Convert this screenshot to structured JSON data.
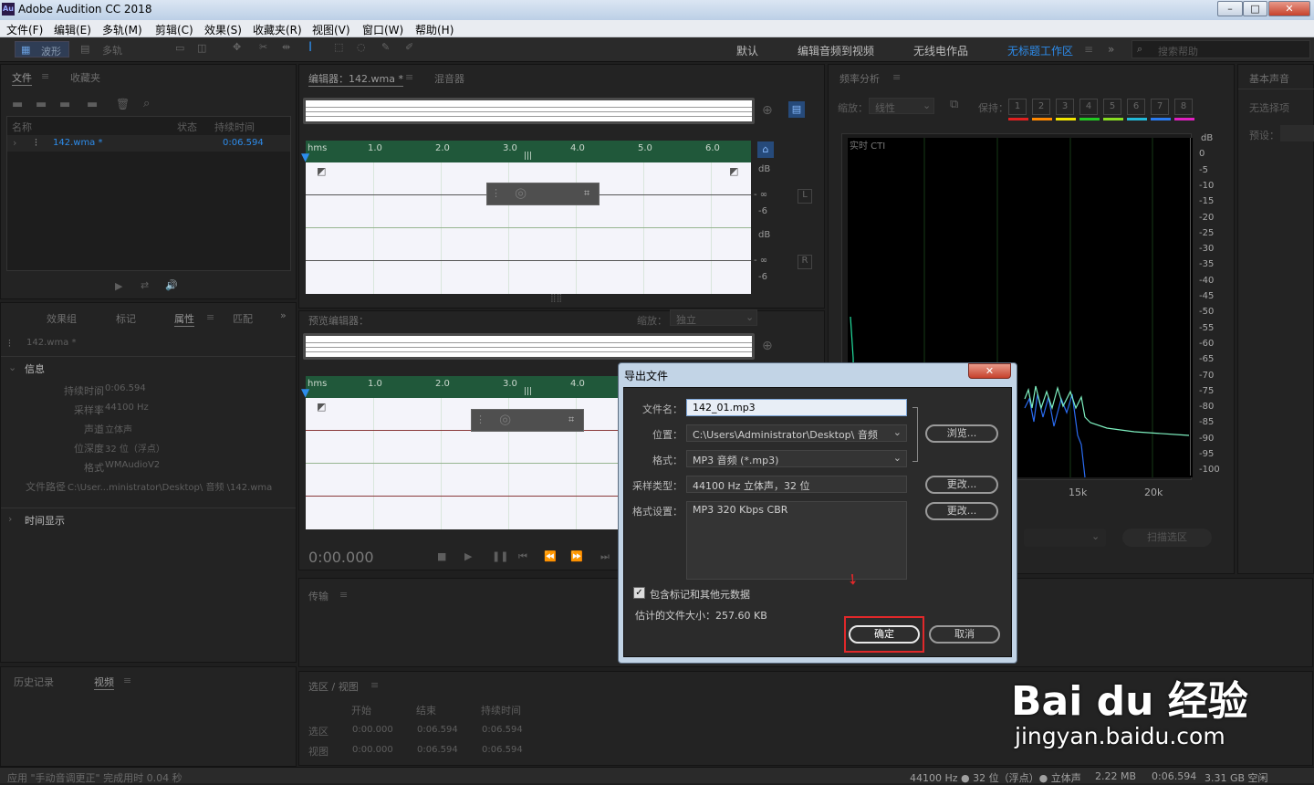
{
  "app": {
    "title": "Adobe Audition CC 2018",
    "logo": "Au"
  },
  "window_controls": [
    "–",
    "□",
    "✕"
  ],
  "menu": [
    "文件(F)",
    "编辑(E)",
    "多轨(M)",
    "剪辑(C)",
    "效果(S)",
    "收藏夹(R)",
    "视图(V)",
    "窗口(W)",
    "帮助(H)"
  ],
  "toolbar": {
    "waveform": "波形",
    "multitrack": "多轨",
    "workspaces": [
      "默认",
      "编辑音频到视频",
      "无线电作品",
      "无标题工作区"
    ],
    "search_placeholder": "搜索帮助"
  },
  "files_panel": {
    "tabs": [
      "文件",
      "收藏夹"
    ],
    "col_name": "名称",
    "col_status": "状态",
    "col_duration": "持续时间",
    "file_name": "142.wma *",
    "file_duration": "0:06.594"
  },
  "props_panel": {
    "tabs": [
      "效果组",
      "标记",
      "属性",
      "匹配"
    ],
    "file": "142.wma *",
    "section_info": "信息",
    "rows": [
      {
        "k": "持续时间",
        "v": "0:06.594"
      },
      {
        "k": "采样率",
        "v": "44100 Hz"
      },
      {
        "k": "声道",
        "v": "立体声"
      },
      {
        "k": "位深度",
        "v": "32 位（浮点）"
      },
      {
        "k": "格式",
        "v": "WMAudioV2"
      },
      {
        "k": "文件路径",
        "v": "C:\\User...ministrator\\Desktop\\ 音频 \\142.wma"
      }
    ],
    "section_time": "时间显示"
  },
  "history_panel": {
    "tabs": [
      "历史记录",
      "视频"
    ]
  },
  "editor": {
    "tab": "编辑器：142.wma *",
    "mixer": "混音器",
    "ruler": [
      "hms",
      "1.0",
      "2.0",
      "3.0",
      "4.0",
      "5.0",
      "6.0"
    ],
    "db_top": "dB",
    "db_inf": "- ∞",
    "db_m6": "-6",
    "ch_l": "L",
    "ch_r": "R"
  },
  "preview": {
    "tab": "预览编辑器：",
    "zoom_label": "缩放：",
    "zoom_value": "独立",
    "ruler": [
      "hms",
      "1.0",
      "2.0",
      "3.0",
      "4.0"
    ],
    "time": "0:00.000"
  },
  "transport": {
    "label": "传输"
  },
  "selection": {
    "title": "选区 / 视图",
    "cols": [
      "开始",
      "结束",
      "持续时间"
    ],
    "rows": [
      {
        "k": "选区",
        "v": [
          "0:00.000",
          "0:06.594",
          "0:06.594"
        ]
      },
      {
        "k": "视图",
        "v": [
          "0:00.000",
          "0:06.594",
          "0:06.594"
        ]
      }
    ]
  },
  "freq": {
    "title": "频率分析",
    "zoom_label": "缩放：",
    "zoom_value": "线性",
    "hold_label": "保持：",
    "holds": [
      "1",
      "2",
      "3",
      "4",
      "5",
      "6",
      "7",
      "8"
    ],
    "hold_colors": [
      "#e02020",
      "#ff8800",
      "#f2e600",
      "#22c922",
      "#88dd22",
      "#22b9d8",
      "#2a7bf0",
      "#e020c0"
    ],
    "realtime": "实时 CTI",
    "y_labels": [
      "dB",
      "0",
      "-5",
      "-10",
      "-15",
      "-20",
      "-25",
      "-30",
      "-35",
      "-40",
      "-45",
      "-50",
      "-55",
      "-60",
      "-65",
      "-70",
      "-75",
      "-80",
      "-85",
      "-90",
      "-95",
      "-100"
    ],
    "x_labels": [
      "15k",
      "20k"
    ],
    "scan": "扫描选区"
  },
  "basic": {
    "title": "基本声音",
    "none": "无选择项",
    "preset": "预设："
  },
  "dialog": {
    "title": "导出文件",
    "filename_label": "文件名：",
    "filename": "142_01.mp3",
    "location_label": "位置：",
    "location": "C:\\Users\\Administrator\\Desktop\\ 音频",
    "format_label": "格式：",
    "format": "MP3 音频 (*.mp3)",
    "browse": "浏览...",
    "sample_label": "采样类型：",
    "sample": "44100 Hz 立体声，32 位",
    "change": "更改...",
    "settings_label": "格式设置：",
    "settings": "MP3 320 Kbps CBR",
    "include_meta": "包含标记和其他元数据",
    "est_size": "估计的文件大小：257.60 KB",
    "ok": "确定",
    "cancel": "取消"
  },
  "status": {
    "left": "应用 \"手动音调更正\" 完成用时 0.04 秒",
    "rate": "44100 Hz ● 32 位（浮点）● 立体声",
    "size": "2.22 MB",
    "dur": "0:06.594",
    "free": "3.31 GB 空闲"
  },
  "watermark": {
    "brand": "Bai du 经验",
    "url": "jingyan.baidu.com"
  }
}
